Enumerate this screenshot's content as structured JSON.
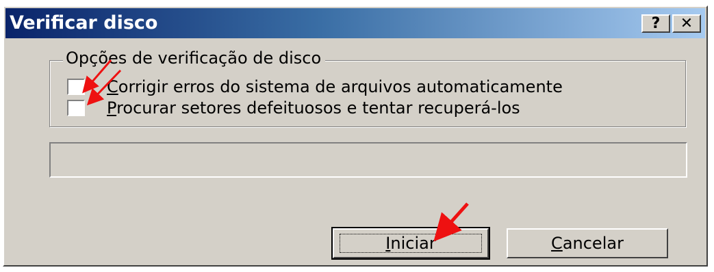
{
  "window": {
    "title": "Verificar disco",
    "help_glyph": "?",
    "close_glyph": "✕"
  },
  "group": {
    "legend": "Opções de verificação de disco"
  },
  "options": [
    {
      "mnemonic": "C",
      "rest": "orrigir erros do sistema de arquivos automaticamente",
      "checked": false
    },
    {
      "mnemonic": "P",
      "rest": "rocurar setores defeituosos e tentar recuperá-los",
      "checked": false
    }
  ],
  "buttons": {
    "start_mnemonic": "I",
    "start_rest": "niciar",
    "cancel_mnemonic": "C",
    "cancel_rest": "ancelar"
  },
  "annotation_color": "#ee1111"
}
